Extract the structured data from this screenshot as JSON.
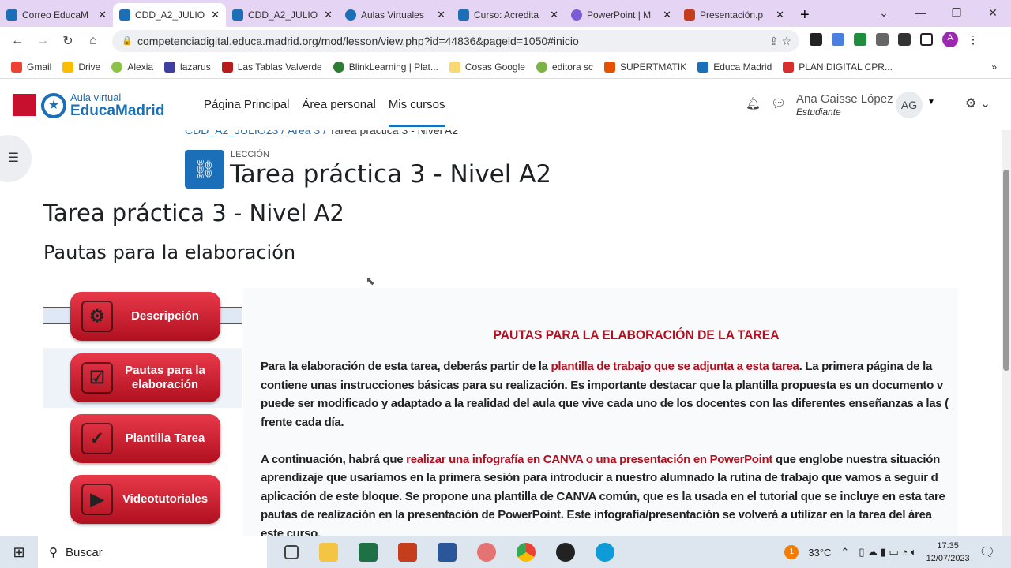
{
  "browser": {
    "tabs": [
      {
        "title": "Correo EducaM",
        "color": "#1b6fb8",
        "active": false
      },
      {
        "title": "CDD_A2_JULIO",
        "color": "#1b6fb8",
        "active": true
      },
      {
        "title": "CDD_A2_JULIO",
        "color": "#1b6fb8",
        "active": false
      },
      {
        "title": "Aulas Virtuales",
        "color": "#1b6fb8",
        "active": false
      },
      {
        "title": "Curso: Acredita",
        "color": "#1b6fb8",
        "active": false
      },
      {
        "title": "PowerPoint | M",
        "color": "#7b5cd6",
        "active": false
      },
      {
        "title": "Presentación.p",
        "color": "#c43e1c",
        "active": false
      }
    ],
    "new_tab": "+",
    "url": "competenciadigital.educa.madrid.org/mod/lesson/view.php?id=44836&pageid=1050#inicio",
    "bookmarks": [
      "Gmail",
      "Drive",
      "Alexia",
      "lazarus",
      "Las Tablas Valverde",
      "BlinkLearning | Plat...",
      "Cosas Google",
      "editora sc",
      "SUPERTMATIK",
      "Educa Madrid",
      "PLAN DIGITAL CPR..."
    ],
    "profile_initial": "A"
  },
  "site": {
    "logo_line1": "Aula virtual",
    "logo_line2": "EducaMadrid",
    "nav": [
      "Página Principal",
      "Área personal",
      "Mis cursos"
    ],
    "user_name": "Ana Gaisse López",
    "user_role": "Estudiante",
    "avatar": "AG"
  },
  "page": {
    "breadcrumb": [
      "CDD_A2_JULIO23",
      "Área 3",
      "Tarea práctica 3 - Nivel A2"
    ],
    "activity_type": "LECCIÓN",
    "activity_title": "Tarea práctica 3 - Nivel A2",
    "heading": "Tarea práctica 3 - Nivel A2",
    "subheading": "Pautas para la elaboración",
    "menu": [
      {
        "label": "Descripción",
        "icon": "gears-icon"
      },
      {
        "label": "Pautas para la elaboración",
        "icon": "checklist-icon"
      },
      {
        "label": "Plantilla Tarea",
        "icon": "calendar-check-icon"
      },
      {
        "label": "Videotutoriales",
        "icon": "video-icon"
      }
    ],
    "panel_title": "PAUTAS PARA LA ELABORACIÓN DE LA TAREA",
    "p1": {
      "a": "Para la elaboración de esta tarea, deberás partir de la ",
      "hl": "plantilla de trabajo que se adjunta a esta tarea",
      "b": ". La primera página de la"
    },
    "p1_lines": [
      "contiene unas instrucciones básicas para su realización. Es importante destacar que la plantilla propuesta es un documento v",
      "puede ser modificado y adaptado a la realidad del aula que vive cada uno de los docentes con las diferentes enseñanzas a las (",
      "frente cada día."
    ],
    "p2": {
      "a": "A continuación, habrá que ",
      "hl": "realizar una infografía en CANVA o una presentación en PowerPoint",
      "b": " que englobe nuestra situación"
    },
    "p2_lines": [
      "aprendizaje que usaríamos en la primera sesión para introducir a nuestro alumnado la rutina de trabajo que vamos a seguir d",
      "aplicación de este bloque. Se propone una plantilla de CANVA común, que es la usada en el tutorial que se incluye en esta tare",
      "pautas de realización en la presentación de PowerPoint. Este infografía/presentación se volverá a utilizar en la tarea  del área",
      "este curso."
    ]
  },
  "taskbar": {
    "search": "Buscar",
    "temperature": "33°C",
    "weather_badge": "1",
    "time": "17:35",
    "date": "12/07/2023"
  },
  "colors": {
    "brand": "#1b6fb8",
    "accent_red": "#b0101f",
    "tabbar": "#e5d4f3"
  }
}
